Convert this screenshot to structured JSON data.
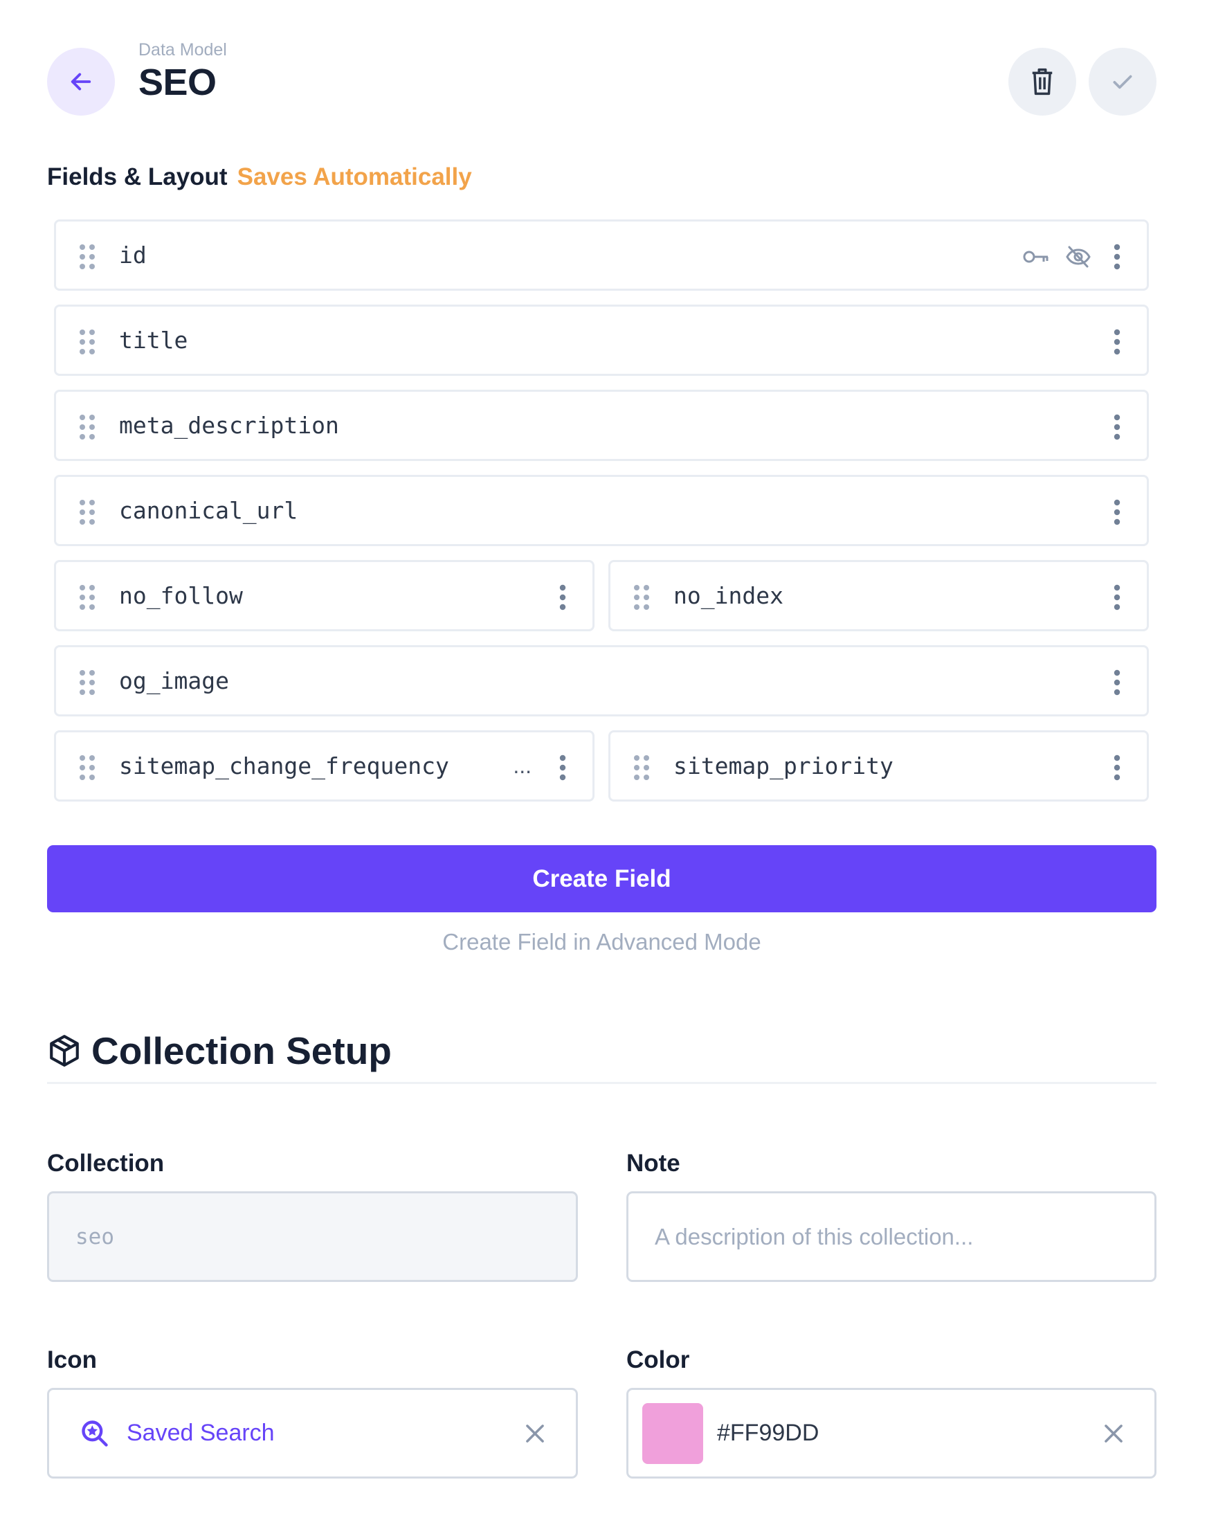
{
  "header": {
    "breadcrumb": "Data Model",
    "title": "SEO"
  },
  "fields_section": {
    "label": "Fields & Layout",
    "status": "Saves Automatically"
  },
  "fields": [
    {
      "name": "id"
    },
    {
      "name": "title"
    },
    {
      "name": "meta_description"
    },
    {
      "name": "canonical_url"
    },
    {
      "name": "no_follow"
    },
    {
      "name": "no_index"
    },
    {
      "name": "og_image"
    },
    {
      "name": "sitemap_change_frequency",
      "overflow": "..."
    },
    {
      "name": "sitemap_priority"
    }
  ],
  "actions": {
    "create_field": "Create Field",
    "create_advanced": "Create Field in Advanced Mode"
  },
  "setup": {
    "title": "Collection Setup",
    "collection_label": "Collection",
    "collection_value": "seo",
    "note_label": "Note",
    "note_placeholder": "A description of this collection...",
    "icon_label": "Icon",
    "icon_value": "Saved Search",
    "color_label": "Color",
    "color_value": "#FF99DD",
    "swatch_color": "#F0A0DB"
  },
  "colors": {
    "accent": "#6644F8",
    "status": "#F2A34A"
  }
}
